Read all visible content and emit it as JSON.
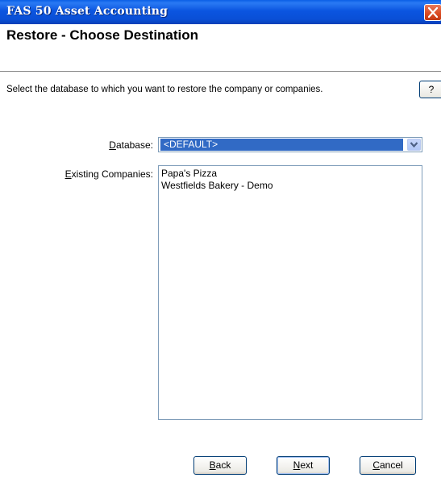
{
  "window": {
    "title": "FAS 50 Asset Accounting",
    "close_icon": "close-icon"
  },
  "header": {
    "heading": "Restore - Choose Destination"
  },
  "instructions": "Select the database to which you want to restore the company or companies.",
  "help": {
    "label": "?"
  },
  "form": {
    "database_label_mnemonic": "D",
    "database_label_rest": "atabase:",
    "database_value": "<DEFAULT>",
    "companies_label_mnemonic": "E",
    "companies_label_rest": "xisting Companies:",
    "companies": [
      "Papa's Pizza",
      "Westfields Bakery - Demo"
    ]
  },
  "buttons": {
    "back_mnemonic": "B",
    "back_rest": "ack",
    "next_mnemonic": "N",
    "next_rest": "ext",
    "cancel_mnemonic": "C",
    "cancel_rest": "ancel"
  },
  "colors": {
    "titlebar": "#0a4fd6",
    "selection": "#316ac5",
    "close": "#d9481f"
  }
}
